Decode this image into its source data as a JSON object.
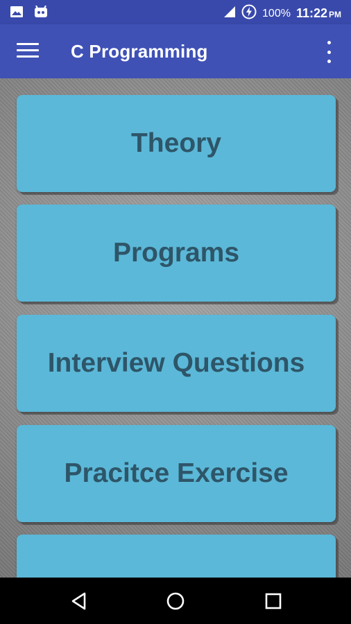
{
  "status_bar": {
    "battery_percent": "100%",
    "time": "11:22",
    "ampm": "PM",
    "icons": [
      "image-icon",
      "android-icon",
      "signal-icon",
      "battery-charging-icon"
    ]
  },
  "app_bar": {
    "title": "C Programming",
    "menu_icon": "hamburger-menu-icon",
    "overflow_icon": "more-vert-icon"
  },
  "menu_cards": [
    {
      "label": "Theory"
    },
    {
      "label": "Programs"
    },
    {
      "label": "Interview Questions"
    },
    {
      "label": "Pracitce Exercise"
    },
    {
      "label": ""
    }
  ],
  "nav_bar": {
    "icons": [
      "back-icon",
      "home-icon",
      "recents-icon"
    ]
  },
  "colors": {
    "status_bar": "#3949ab",
    "app_bar": "#3f51b5",
    "card_background": "#5bb8d8",
    "card_text": "#2e5568"
  }
}
